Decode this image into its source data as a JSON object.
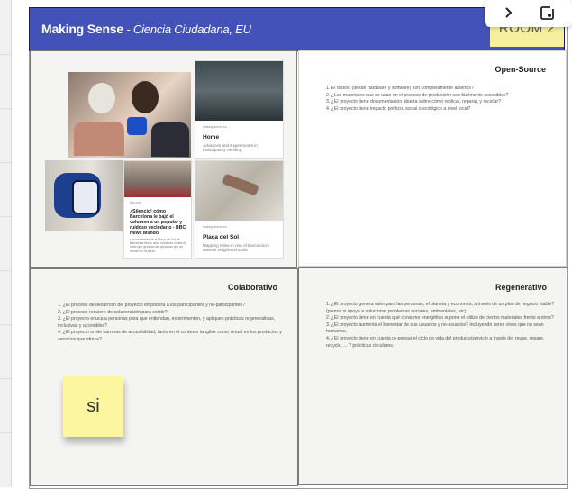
{
  "header": {
    "title": "Making Sense",
    "separator": " - ",
    "subtitle": "Ciencia Ciudadana, EU",
    "room_label": "ROOM 2",
    "color": "#4252b8"
  },
  "toolbar": {
    "icons": [
      "chevron-right-icon",
      "add-note-icon"
    ]
  },
  "media": {
    "cards": [
      {
        "site": "making-sense.eu",
        "title": "Home",
        "desc": "Advances and Experiments in Participatory Sensing"
      },
      {
        "site": "bbc.com",
        "title": "¿Silencio! cómo Barcelona le bajó el volumen a un popular y ruidoso vecindario - BBC News Mundo",
        "desc": "Los residentes de la Plaça del Sol de Barcelona llevan años luchando contra el ruido que generan las personas que se reúnen en la plaza."
      },
      {
        "site": "making-sense.eu",
        "title": "Plaça del Sol",
        "desc": "Mapping noise in one of Barcelona's noisiest neighbourhoods"
      }
    ]
  },
  "open_source": {
    "title": "Open-Source",
    "items": [
      "1. El diseño (desde hardware y software) son completamente abiertos?",
      "2. ¿Los materiales que se usan en el proceso de producción son fácilmente accesibles?",
      "3. ¿El proyecto tiene documentación abierta sobre cómo replicar, reparar, y reciclar?",
      "4. ¿El proyecto tiene impacto político, social o ecológico a nivel local?"
    ]
  },
  "colaborativo": {
    "title": "Colaborativo",
    "items": [
      "1. ¿El proceso de desarrollo del proyecto empodera a los participantes y no-participantes?",
      "2. ¿El proceso requiere de colaboración para existir?",
      "3. ¿El proyecto educa a personas para que entiendan, experimenten, y apliquen prácticas regenerativas, inclusivas y accesibles?",
      "4. ¿El proyecto omite barreras de accesibilidad, tanto en el contexto tangible como virtual en los productos y servicios que ofrece?"
    ],
    "sticky_note": "si"
  },
  "regenerativo": {
    "title": "Regenerativo",
    "items": [
      "1. ¿El proyecto genera valor para las personas, el planeta y economía, a través de un plan de negocio viable? (piensa si apoya a solucionar problemas sociales, ambientales, etc)",
      "2. ¿El proyecto tiene en cuenta qué consumo energético supone el utilizo de ciertos materiales frente a otros?",
      "3. ¿El proyecto aumenta el bienestar de sus usuarios y no-usuarios? incluyendo seres vivos que no sean humanos,",
      "4. ¿El proyecto tiene en cuenta re-pensar el ciclo de vida del producto/servicio a través de: reuse, repare, recycle, ... ? prácticas circulares."
    ]
  }
}
